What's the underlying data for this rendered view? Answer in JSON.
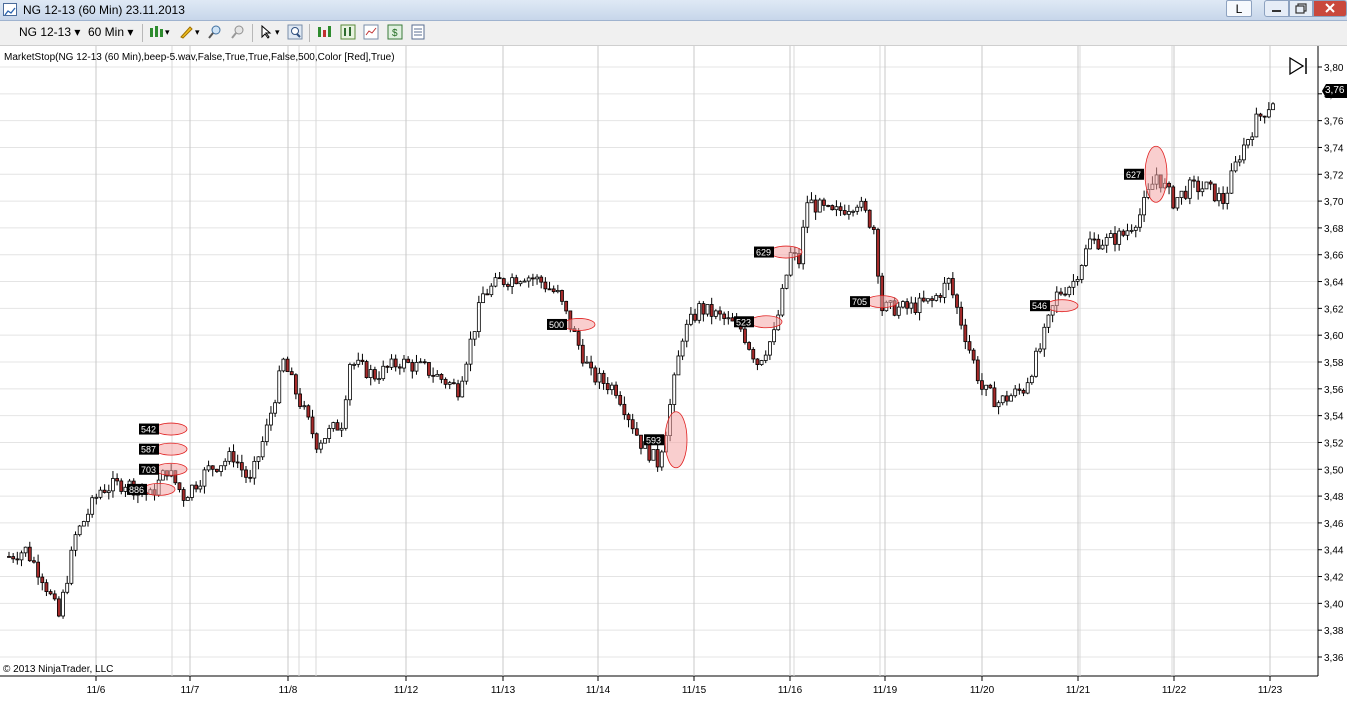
{
  "window": {
    "title": "NG 12-13 (60 Min)  23.11.2013",
    "link_button": "L",
    "min_label": "—",
    "max_label": "▢",
    "close_label": "X"
  },
  "toolbar": {
    "instrument": "NG 12-13",
    "interval": "60 Min",
    "icons": [
      "chart-style-icon",
      "drawing-pen-icon",
      "zoom-in-icon",
      "zoom-out-icon",
      "pointer-icon",
      "magnifier-icon",
      "strategies-icon",
      "indicators-icon",
      "chart-properties-icon",
      "money-icon",
      "data-box-icon"
    ]
  },
  "indicator_label": "MarketStop(NG 12-13 (60 Min),beep-5.wav,False,True,True,False,500,Color [Red],True)",
  "copyright": "© 2013 NinjaTrader, LLC",
  "last_price_tag": "3,76",
  "colors": {
    "up_candle": "#ffffff",
    "down_candle": "#a52a2a",
    "outline": "#000000",
    "marker_fill": "#f4a6a6",
    "marker_stroke": "#e02020",
    "grid": "#c8c8c8"
  },
  "chart_data": {
    "type": "candlestick",
    "y_axis_labels": [
      "3,80",
      "3,78",
      "3,76",
      "3,74",
      "3,72",
      "3,70",
      "3,68",
      "3,66",
      "3,64",
      "3,62",
      "3,60",
      "3,58",
      "3,56",
      "3,54",
      "3,52",
      "3,50",
      "3,48",
      "3,46",
      "3,44",
      "3,42",
      "3,40",
      "3,38",
      "3,36"
    ],
    "ylim": [
      3.36,
      3.8
    ],
    "x_axis_labels": [
      "11/6",
      "11/7",
      "11/8",
      "11/12",
      "11/13",
      "11/14",
      "11/15",
      "11/16",
      "11/19",
      "11/20",
      "11/21",
      "11/22",
      "11/23"
    ],
    "trend_anchors": [
      [
        0,
        3.435
      ],
      [
        4,
        3.44
      ],
      [
        8,
        3.42
      ],
      [
        12,
        3.39
      ],
      [
        16,
        3.45
      ],
      [
        22,
        3.485
      ],
      [
        28,
        3.49
      ],
      [
        34,
        3.48
      ],
      [
        38,
        3.5
      ],
      [
        42,
        3.48
      ],
      [
        48,
        3.5
      ],
      [
        54,
        3.51
      ],
      [
        58,
        3.49
      ],
      [
        62,
        3.53
      ],
      [
        66,
        3.58
      ],
      [
        70,
        3.55
      ],
      [
        74,
        3.52
      ],
      [
        80,
        3.535
      ],
      [
        82,
        3.58
      ],
      [
        88,
        3.57
      ],
      [
        94,
        3.58
      ],
      [
        100,
        3.575
      ],
      [
        108,
        3.56
      ],
      [
        114,
        3.63
      ],
      [
        118,
        3.64
      ],
      [
        124,
        3.645
      ],
      [
        128,
        3.64
      ],
      [
        132,
        3.63
      ],
      [
        136,
        3.6
      ],
      [
        140,
        3.57
      ],
      [
        146,
        3.56
      ],
      [
        152,
        3.52
      ],
      [
        156,
        3.505
      ],
      [
        158,
        3.53
      ],
      [
        162,
        3.6
      ],
      [
        166,
        3.62
      ],
      [
        170,
        3.615
      ],
      [
        176,
        3.605
      ],
      [
        180,
        3.58
      ],
      [
        184,
        3.6
      ],
      [
        188,
        3.66
      ],
      [
        190,
        3.655
      ],
      [
        192,
        3.7
      ],
      [
        198,
        3.69
      ],
      [
        204,
        3.7
      ],
      [
        208,
        3.68
      ],
      [
        210,
        3.62
      ],
      [
        216,
        3.62
      ],
      [
        222,
        3.625
      ],
      [
        226,
        3.64
      ],
      [
        230,
        3.6
      ],
      [
        234,
        3.56
      ],
      [
        238,
        3.55
      ],
      [
        244,
        3.56
      ],
      [
        248,
        3.59
      ],
      [
        252,
        3.63
      ],
      [
        256,
        3.64
      ],
      [
        260,
        3.67
      ],
      [
        264,
        3.67
      ],
      [
        268,
        3.675
      ],
      [
        272,
        3.69
      ],
      [
        276,
        3.72
      ],
      [
        280,
        3.7
      ],
      [
        284,
        3.71
      ],
      [
        288,
        3.71
      ],
      [
        292,
        3.7
      ],
      [
        296,
        3.735
      ],
      [
        300,
        3.76
      ],
      [
        304,
        3.775
      ]
    ],
    "stop_markers": [
      {
        "label": "542",
        "price": 3.53
      },
      {
        "label": "587",
        "price": 3.515
      },
      {
        "label": "703",
        "price": 3.5
      },
      {
        "label": "886",
        "price": 3.485
      },
      {
        "label": "500",
        "price": 3.608
      },
      {
        "label": "593",
        "price": 3.522
      },
      {
        "label": "523",
        "price": 3.61
      },
      {
        "label": "629",
        "price": 3.662
      },
      {
        "label": "705",
        "price": 3.625
      },
      {
        "label": "546",
        "price": 3.622
      },
      {
        "label": "627",
        "price": 3.72
      }
    ]
  }
}
